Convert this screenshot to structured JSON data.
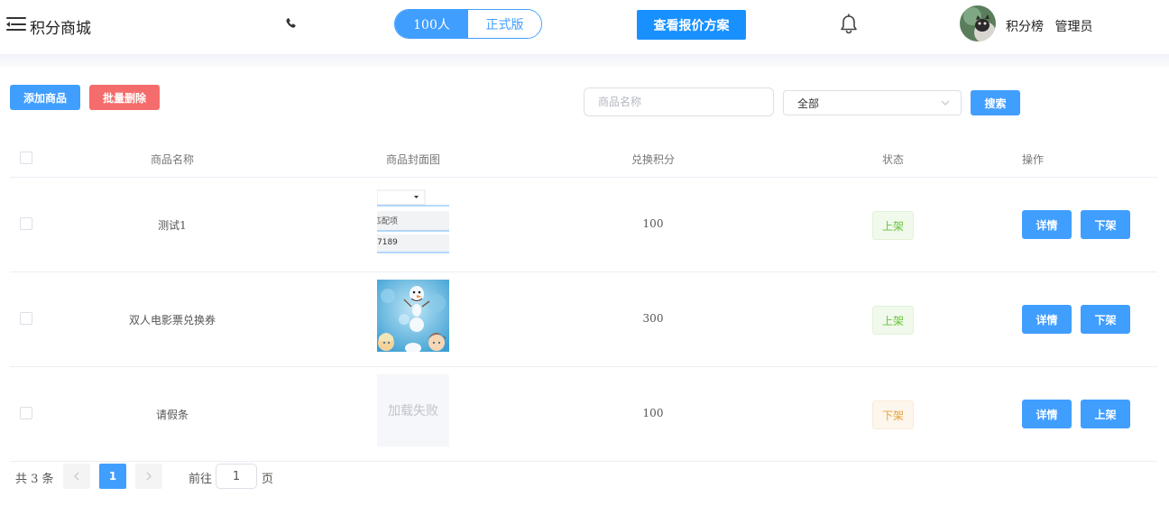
{
  "header": {
    "title": "积分商城",
    "segment": {
      "active": "100人",
      "inactive": "正式版"
    },
    "quote_button": "查看报价方案",
    "nav": {
      "leaderboard": "积分榜",
      "admin": "管理员"
    }
  },
  "toolbar": {
    "add_label": "添加商品",
    "batch_delete_label": "批量删除",
    "search_placeholder": "商品名称",
    "status_select_value": "全部",
    "search_button": "搜索"
  },
  "table": {
    "headers": [
      "商品名称",
      "商品封面图",
      "兑换积分",
      "状态",
      "操作"
    ],
    "rows": [
      {
        "name": "测试1",
        "points": "100",
        "status": "上架",
        "status_type": "on",
        "detail": "详情",
        "toggle": "下架",
        "thumb": "form",
        "thumb_text": [
          "匹配项",
          "7189"
        ]
      },
      {
        "name": "双人电影票兑换券",
        "points": "300",
        "status": "上架",
        "status_type": "on",
        "detail": "详情",
        "toggle": "下架",
        "thumb": "frozen"
      },
      {
        "name": "请假条",
        "points": "100",
        "status": "下架",
        "status_type": "off",
        "detail": "详情",
        "toggle": "上架",
        "thumb": "failed",
        "thumb_text": "加载失败"
      }
    ]
  },
  "pagination": {
    "total": "共 3 条",
    "current_page": "1",
    "goto_prefix": "前往",
    "goto_value": "1",
    "goto_suffix": "页"
  },
  "colors": {
    "primary": "#409eff",
    "danger": "#f56c6c",
    "success": "#67c23a",
    "warning": "#e6a23c"
  },
  "icons": [
    "menu-icon",
    "phone-icon",
    "bell-icon",
    "chevron-down-icon",
    "chevron-left-icon",
    "chevron-right-icon"
  ]
}
